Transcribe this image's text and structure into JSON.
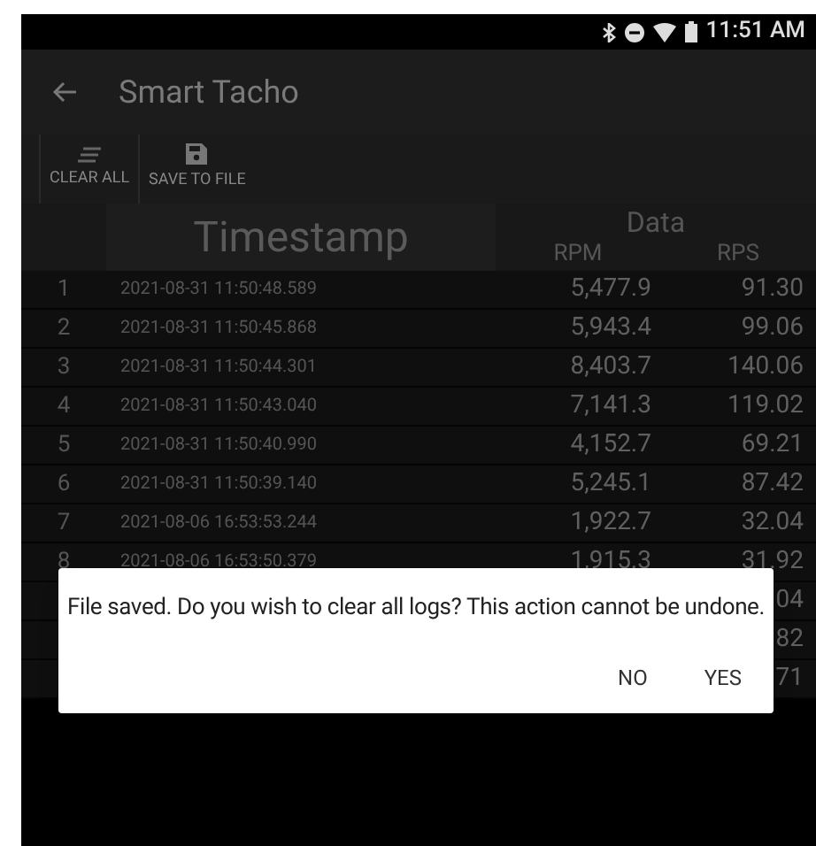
{
  "status_bar": {
    "time": "11:51 AM"
  },
  "app_bar": {
    "title": "Smart Tacho"
  },
  "toolbar": [
    {
      "kind": "clear",
      "label": "CLEAR ALL"
    },
    {
      "kind": "save",
      "label": "SAVE TO FILE"
    }
  ],
  "table": {
    "columns": {
      "timestamp": "Timestamp",
      "data": "Data",
      "rpm": "RPM",
      "rps": "RPS"
    },
    "rows": [
      {
        "index": "1",
        "timestamp": "2021-08-31 11:50:48.589",
        "rpm": "5,477.9",
        "rps": "91.30"
      },
      {
        "index": "2",
        "timestamp": "2021-08-31 11:50:45.868",
        "rpm": "5,943.4",
        "rps": "99.06"
      },
      {
        "index": "3",
        "timestamp": "2021-08-31 11:50:44.301",
        "rpm": "8,403.7",
        "rps": "140.06"
      },
      {
        "index": "4",
        "timestamp": "2021-08-31 11:50:43.040",
        "rpm": "7,141.3",
        "rps": "119.02"
      },
      {
        "index": "5",
        "timestamp": "2021-08-31 11:50:40.990",
        "rpm": "4,152.7",
        "rps": "69.21"
      },
      {
        "index": "6",
        "timestamp": "2021-08-31 11:50:39.140",
        "rpm": "5,245.1",
        "rps": "87.42"
      },
      {
        "index": "7",
        "timestamp": "2021-08-06 16:53:53.244",
        "rpm": "1,922.7",
        "rps": "32.04"
      },
      {
        "index": "8",
        "timestamp": "2021-08-06 16:53:50.379",
        "rpm": "1,915.3",
        "rps": "31.92"
      },
      {
        "rps": "04"
      },
      {
        "rps": "82"
      },
      {
        "rps": "71"
      }
    ]
  },
  "dialog": {
    "message": "File saved. Do you wish to clear all logs? This action cannot be undone.",
    "buttons": [
      "NO",
      "YES"
    ]
  }
}
